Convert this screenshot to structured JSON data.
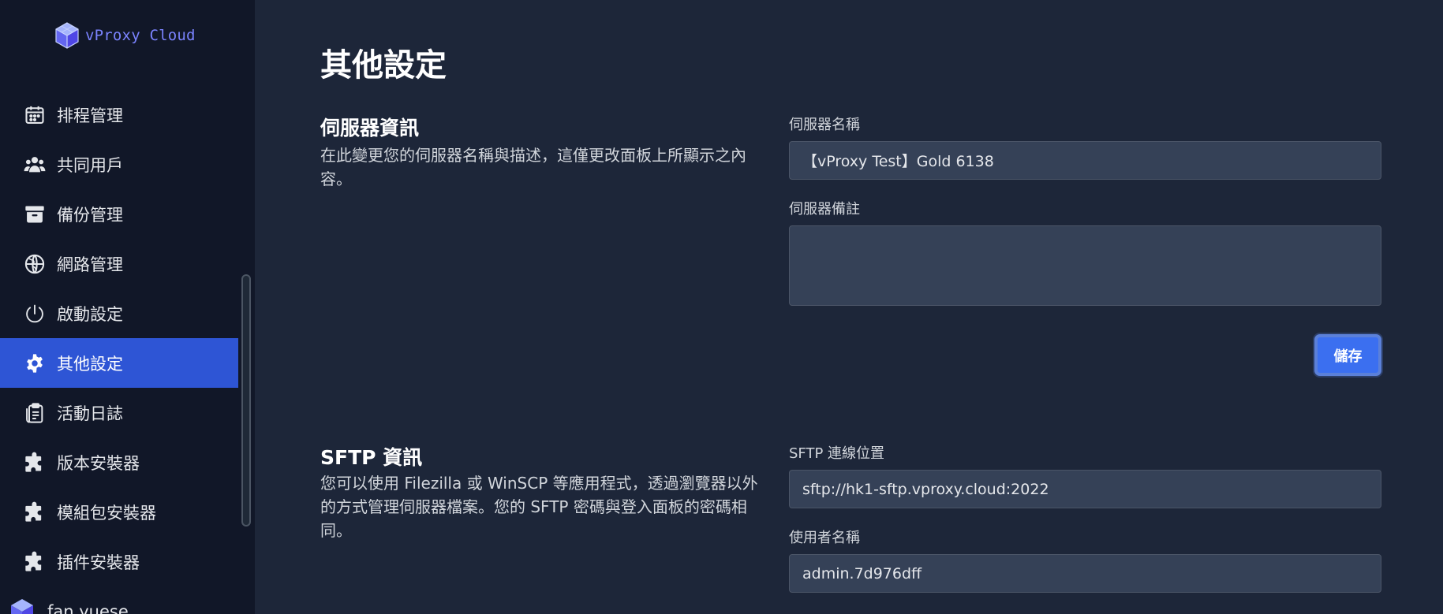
{
  "brand": {
    "name": "vProxy Cloud"
  },
  "sidebar": {
    "items": [
      {
        "label": "排程管理",
        "icon": "calendar-icon"
      },
      {
        "label": "共同用戶",
        "icon": "users-icon"
      },
      {
        "label": "備份管理",
        "icon": "archive-icon"
      },
      {
        "label": "網路管理",
        "icon": "globe-icon"
      },
      {
        "label": "啟動設定",
        "icon": "power-icon"
      },
      {
        "label": "其他設定",
        "icon": "gear-icon",
        "active": true
      },
      {
        "label": "活動日誌",
        "icon": "clipboard-icon"
      },
      {
        "label": "版本安裝器",
        "icon": "puzzle-icon"
      },
      {
        "label": "模組包安裝器",
        "icon": "puzzle-icon"
      },
      {
        "label": "插件安裝器",
        "icon": "puzzle-icon"
      }
    ],
    "account_name": "fan yuese"
  },
  "main": {
    "title": "其他設定",
    "server_info": {
      "title": "伺服器資訊",
      "description": "在此變更您的伺服器名稱與描述，這僅更改面板上所顯示之內容。",
      "name_label": "伺服器名稱",
      "name_value": "【vProxy Test】Gold 6138",
      "note_label": "伺服器備註",
      "note_value": "",
      "save_label": "儲存"
    },
    "sftp_info": {
      "title": "SFTP 資訊",
      "description": "您可以使用 Filezilla 或 WinSCP 等應用程式，透過瀏覽器以外的方式管理伺服器檔案。您的 SFTP 密碼與登入面板的密碼相同。",
      "address_label": "SFTP 連線位置",
      "address_value": "sftp://hk1-sftp.vproxy.cloud:2022",
      "username_label": "使用者名稱",
      "username_value": "admin.7d976dff"
    }
  },
  "colors": {
    "sidebar_bg": "#111728",
    "main_bg": "#1d2639",
    "active_item": "#2e55d5",
    "brand": "#7b83ff",
    "button": "#3b6ff0",
    "input_bg": "#354157"
  }
}
